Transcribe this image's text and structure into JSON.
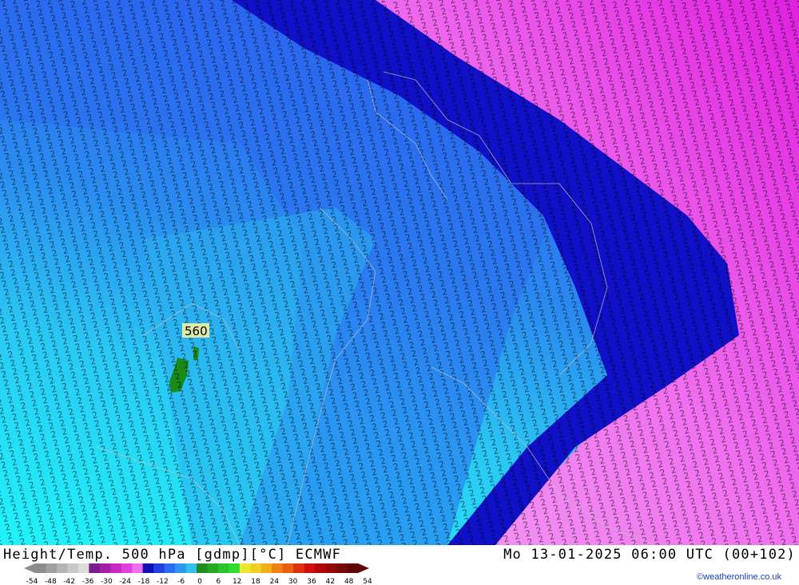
{
  "title": "Height/Temp. 500 hPa [gdmp][°C] ECMWF",
  "datetime": "Mo 13-01-2025 06:00 UTC (00+102)",
  "credit": "©weatheronline.co.uk",
  "contour_label": "560",
  "legend": {
    "ticks": [
      "-54",
      "-48",
      "-42",
      "-36",
      "-30",
      "-24",
      "-18",
      "-12",
      "-6",
      "0",
      "6",
      "12",
      "18",
      "24",
      "30",
      "36",
      "42",
      "48",
      "54"
    ],
    "colors": [
      "#8c8c8c",
      "#a0a0a0",
      "#b4b4b4",
      "#c8c8c8",
      "#dcdcdc",
      "#7a1c8c",
      "#a020a8",
      "#c828c8",
      "#e040e0",
      "#f070f0",
      "#1010b4",
      "#2040e0",
      "#2a6cf0",
      "#2e96f0",
      "#30c0ec",
      "#1e8c1e",
      "#22a822",
      "#2ac42a",
      "#30dc30",
      "#e8e830",
      "#f0d020",
      "#f0b018",
      "#f08010",
      "#e86010",
      "#e03010",
      "#d01010",
      "#b40808",
      "#960808",
      "#780808",
      "#600808"
    ]
  },
  "colors": {
    "cyan": "#22f0f8",
    "light_blue": "#2aa8f0",
    "blue": "#2a5cf0",
    "dark_blue": "#1010c8",
    "magenta": "#ee44ee",
    "pink": "#f488f0",
    "green": "#1a8a1a"
  }
}
